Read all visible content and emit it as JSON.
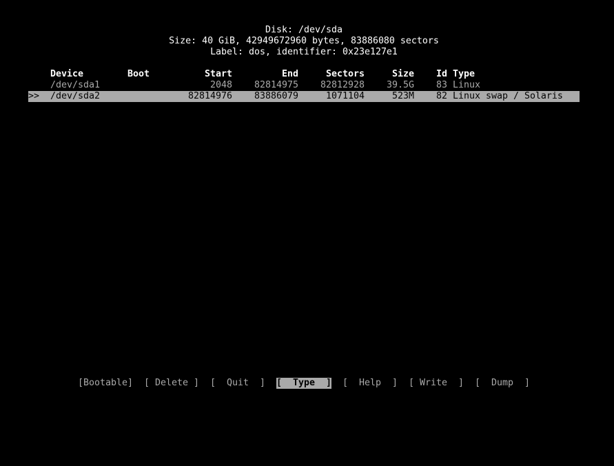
{
  "header": {
    "disk": "Disk: /dev/sda",
    "size": "Size: 40 GiB, 42949672960 bytes, 83886080 sectors",
    "label": "Label: dos, identifier: 0x23e127e1"
  },
  "table": {
    "columns": {
      "device": "Device",
      "boot": "Boot",
      "start": "Start",
      "end": "End",
      "sectors": "Sectors",
      "size": "Size",
      "id": "Id",
      "type": "Type"
    },
    "selected_marker": ">>",
    "rows": [
      {
        "device": "/dev/sda1",
        "boot": "",
        "start": "2048",
        "end": "82814975",
        "sectors": "82812928",
        "size": "39.5G",
        "id": "83",
        "type": "Linux",
        "selected": false
      },
      {
        "device": "/dev/sda2",
        "boot": "",
        "start": "82814976",
        "end": "83886079",
        "sectors": "1071104",
        "size": "523M",
        "id": "82",
        "type": "Linux swap / Solaris",
        "selected": true
      }
    ]
  },
  "menu": {
    "items": [
      "[Bootable]",
      "[ Delete ]",
      "[  Quit  ]",
      "[  Type  ]",
      "[  Help  ]",
      "[ Write  ]",
      "[  Dump  ]"
    ],
    "selected": "[  Type  ]"
  },
  "colors": {
    "background": "#000000",
    "text": "#aaaaaa",
    "highlight": "#aaaaaa"
  }
}
